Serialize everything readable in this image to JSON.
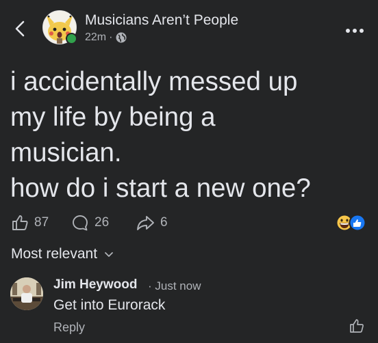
{
  "header": {
    "group_name": "Musicians Aren’t People",
    "time": "22m",
    "separator": "·",
    "icons": {
      "back": "chevron-left-icon",
      "privacy": "globe-icon",
      "more": "more-dots-icon"
    }
  },
  "post": {
    "text": "i accidentally messed up\nmy life by being a\nmusician.\nhow do i start a new one?",
    "likes": "87",
    "comments": "26",
    "shares": "6",
    "reactions": [
      "grinning-emoji-icon",
      "like-reaction-icon"
    ]
  },
  "sort": {
    "label": "Most relevant"
  },
  "comment": {
    "author": "Jim Heywood",
    "time": "· Just now",
    "text": "Get into Eurorack",
    "reply_label": "Reply"
  },
  "colors": {
    "background": "#242526",
    "text_primary": "#e4e6eb",
    "text_secondary": "#b0b3b8",
    "online": "#31a24c",
    "like_blue": "#1877f2"
  }
}
